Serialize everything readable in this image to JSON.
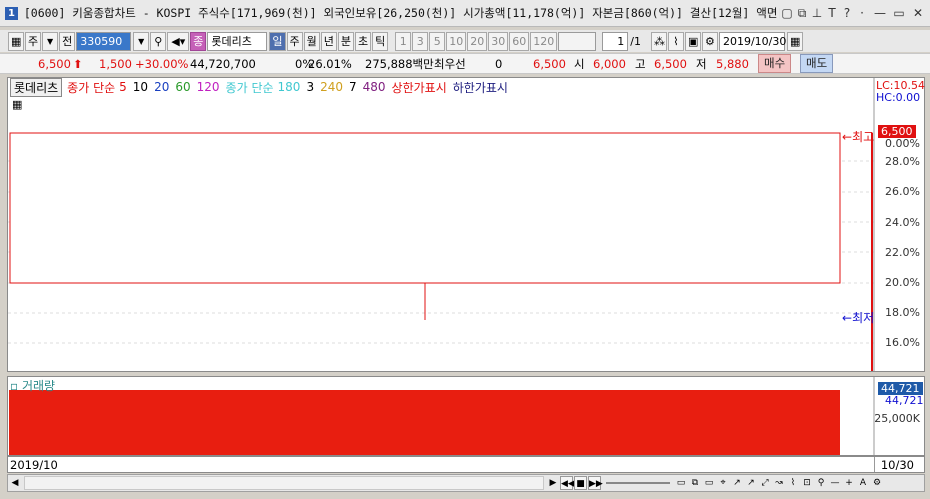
{
  "title": {
    "window_num": "1",
    "text": "[0600] 키움종합차트 - KOSPI 주식수[171,969(천)] 외국인보유[26,250(천)] 시가총액[11,178(억)] 자본금[860(억)] 결산[12월] 액면[5"
  },
  "toolbar": {
    "type": "주",
    "all": "전",
    "code": "330590",
    "stock_name": "롯데리츠",
    "stock_prefix": "종",
    "periods": [
      "일",
      "주",
      "월",
      "년",
      "분",
      "초",
      "틱"
    ],
    "intervals": [
      "1",
      "3",
      "5",
      "10",
      "20",
      "30",
      "60",
      "120"
    ],
    "page": "1",
    "page_total": "/1",
    "date": "2019/10/30"
  },
  "price": {
    "current": "6,500",
    "change": "1,500",
    "change_pct": "+30.00%",
    "volume": "44,720,700",
    "pct_text": "0%",
    "turnover": "26.01%",
    "amount": "275,888백만",
    "best_priority": "최우선",
    "best_qty": "0",
    "best_price": "6,500",
    "open_label": "시",
    "open": "6,000",
    "high_label": "고",
    "high": "6,500",
    "low_label": "저",
    "low": "5,880",
    "buy": "매수",
    "sell": "매도"
  },
  "legend": {
    "stock": "롯데리츠",
    "ma1_label": "종가 단순",
    "ma1_values": [
      "5",
      "10",
      "20",
      "60",
      "120"
    ],
    "ma2_label": "종가 단순",
    "ma2_values": [
      "180",
      "3",
      "240",
      "7",
      "480"
    ],
    "upper": "상한가표시",
    "lower": "하한가표시"
  },
  "axis": {
    "lc": "LC:10.54",
    "hc": "HC:0.00",
    "price_tag": "6,500",
    "ticks": [
      "0.00%",
      "28.0%",
      "26.0%",
      "24.0%",
      "22.0%",
      "20.0%",
      "18.0%",
      "16.0%"
    ],
    "max_mark": "최고",
    "min_mark": "최저"
  },
  "volume_panel": {
    "title": "거래량",
    "tag": "44,721",
    "tag2": "44,721",
    "tick": "25,000K"
  },
  "dates": {
    "left": "2019/10",
    "right": "10/30"
  },
  "colors": {
    "up": "#e01010",
    "down": "#1010d0",
    "candle": "#e01010"
  }
}
